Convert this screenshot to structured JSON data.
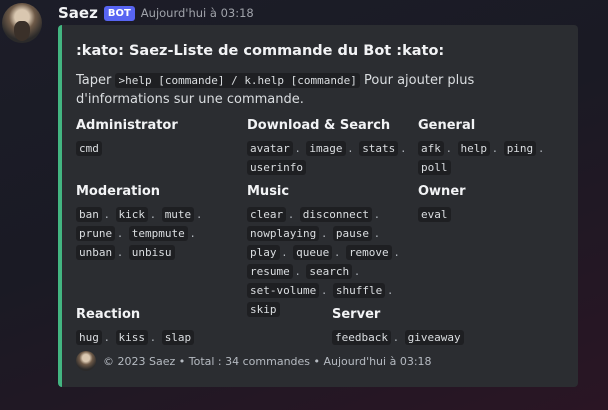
{
  "message": {
    "username": "Saez",
    "bot_badge": "BOT",
    "timestamp": "Aujourd'hui à 03:18"
  },
  "embed": {
    "accent_color": "#43b581",
    "title": ":kato: Saez-Liste de commande du Bot :kato:",
    "description_prefix": "Taper ",
    "description_code": ">help [commande] / k.help [commande]",
    "description_suffix": " Pour ajouter plus d'informations sur une commande.",
    "fields": [
      {
        "name": "Administrator",
        "commands": [
          "cmd"
        ]
      },
      {
        "name": "Download & Search",
        "commands": [
          "avatar",
          "image",
          "stats",
          "userinfo"
        ]
      },
      {
        "name": "General",
        "commands": [
          "afk",
          "help",
          "ping",
          "poll"
        ]
      },
      {
        "name": "Moderation",
        "commands": [
          "ban",
          "kick",
          "mute",
          "prune",
          "tempmute",
          "unban",
          "unbisu"
        ]
      },
      {
        "name": "Music",
        "commands": [
          "clear",
          "disconnect",
          "nowplaying",
          "pause",
          "play",
          "queue",
          "remove",
          "resume",
          "search",
          "set-volume",
          "shuffle",
          "skip"
        ]
      },
      {
        "name": "Owner",
        "commands": [
          "eval"
        ]
      },
      {
        "name": "Reaction",
        "commands": [
          "hug",
          "kiss",
          "slap"
        ]
      },
      {
        "name": "Server",
        "commands": [
          "feedback",
          "giveaway"
        ]
      }
    ],
    "footer_text": "© 2023 Saez • Total : 34 commandes • Aujourd'hui à 03:18"
  }
}
